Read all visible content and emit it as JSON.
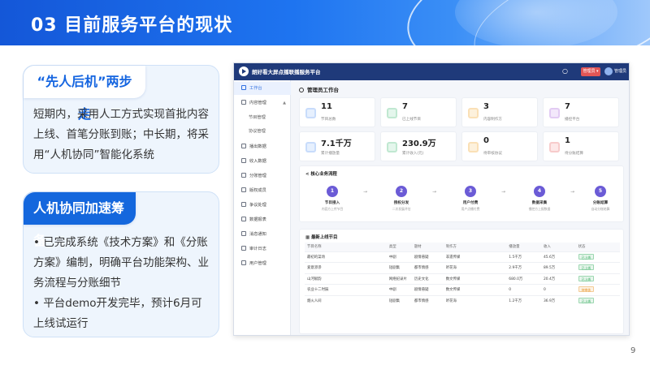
{
  "slide": {
    "title": "03 目前服务平台的现状",
    "page_number": "9"
  },
  "card1": {
    "title": "“先人后机”两步走",
    "body": "短期内，采用人工方式实现首批内容上线、首笔分账到账；中长期，将采用“人机协同”智能化系统"
  },
  "card2": {
    "title": "人机协同加速筹备",
    "bullet1": "• 已完成系统《技术方案》和《分账方案》编制，明确平台功能架构、业务流程与分账细节",
    "bullet2": "• 平台demo开发完毕，预计6月可上线试运行"
  },
  "app": {
    "title": "朗好看大屏点播联播服务平台",
    "role_button": "管理员 ▾",
    "username": "管理员",
    "bell_icon": "bell-icon",
    "page_title": "管理员工作台"
  },
  "sidebar": {
    "items": [
      {
        "label": "工作台",
        "icon": "home-icon"
      },
      {
        "label": "内容管理",
        "icon": "content-icon"
      },
      {
        "label": "节目管理",
        "icon": ""
      },
      {
        "label": "协议管理",
        "icon": ""
      },
      {
        "label": "播出数据",
        "icon": "data-icon"
      },
      {
        "label": "收入数据",
        "icon": "income-icon"
      },
      {
        "label": "分账管理",
        "icon": "split-icon"
      },
      {
        "label": "版权成员",
        "icon": "member-icon"
      },
      {
        "label": "争议处理",
        "icon": "dispute-icon"
      },
      {
        "label": "数据报表",
        "icon": "report-icon"
      },
      {
        "label": "消息通知",
        "icon": "message-icon"
      },
      {
        "label": "审计日志",
        "icon": "audit-icon"
      },
      {
        "label": "用户管理",
        "icon": "user-icon"
      }
    ]
  },
  "stats": [
    {
      "value": "11",
      "label": "节目总数",
      "color": "#4f8ef0",
      "bg": "#e6f0fe"
    },
    {
      "value": "7",
      "label": "已上线节目",
      "color": "#34b26a",
      "bg": "#e4f6ec"
    },
    {
      "value": "3",
      "label": "内容制作方",
      "color": "#f0a020",
      "bg": "#fdf1dc"
    },
    {
      "value": "7",
      "label": "播控平台",
      "color": "#a25ad6",
      "bg": "#f3e8fb"
    },
    {
      "value": "7.1千万",
      "label": "累计播放量",
      "color": "#4f8ef0",
      "bg": "#e6f0fe"
    },
    {
      "value": "230.9万",
      "label": "累计收入(元)",
      "color": "#34b26a",
      "bg": "#e4f6ec"
    },
    {
      "value": "0",
      "label": "待审核协议",
      "color": "#f0a020",
      "bg": "#fdf1dc"
    },
    {
      "value": "1",
      "label": "待分账结算",
      "color": "#e05a5a",
      "bg": "#fde8e8"
    }
  ],
  "flow": {
    "title": "核心业务流程",
    "steps": [
      {
        "num": "1",
        "title": "节目接入",
        "desc": "内容方上传节目"
      },
      {
        "num": "2",
        "title": "授权分发",
        "desc": "二次发展评估"
      },
      {
        "num": "3",
        "title": "用户付费",
        "desc": "用户点播付费"
      },
      {
        "num": "4",
        "title": "数据采集",
        "desc": "播控方上报数据"
      },
      {
        "num": "5",
        "title": "分账结算",
        "desc": "自动分账结算"
      }
    ]
  },
  "table": {
    "title": "最新上线节目",
    "headers": [
      "节目名称",
      "类型",
      "题材",
      "制作方",
      "播放量",
      "收入",
      "状态"
    ],
    "rows": [
      [
        "最初的菜场",
        "中剧",
        "剧情悬疑",
        "非遗传媒",
        "1.5千万",
        "45.6万",
        "已上线"
      ],
      [
        "爱意渗渗",
        "短剧集",
        "都市情感",
        "听花海",
        "2.9千万",
        "89.5万",
        "已上线"
      ],
      [
        "山河赋韵",
        "网络纪录片",
        "历史文化",
        "数文传媒",
        "680.0万",
        "20.4万",
        "已上线"
      ],
      [
        "农业十二时辰",
        "中剧",
        "剧情悬疑",
        "数文传媒",
        "0",
        "0",
        "待审核"
      ],
      [
        "烟火人间",
        "短剧集",
        "都市情感",
        "听花海",
        "1.2千万",
        "36.9万",
        "已上线"
      ]
    ],
    "status_colors": {
      "已上线": "#2eaa5a",
      "待审核": "#e89020"
    }
  }
}
